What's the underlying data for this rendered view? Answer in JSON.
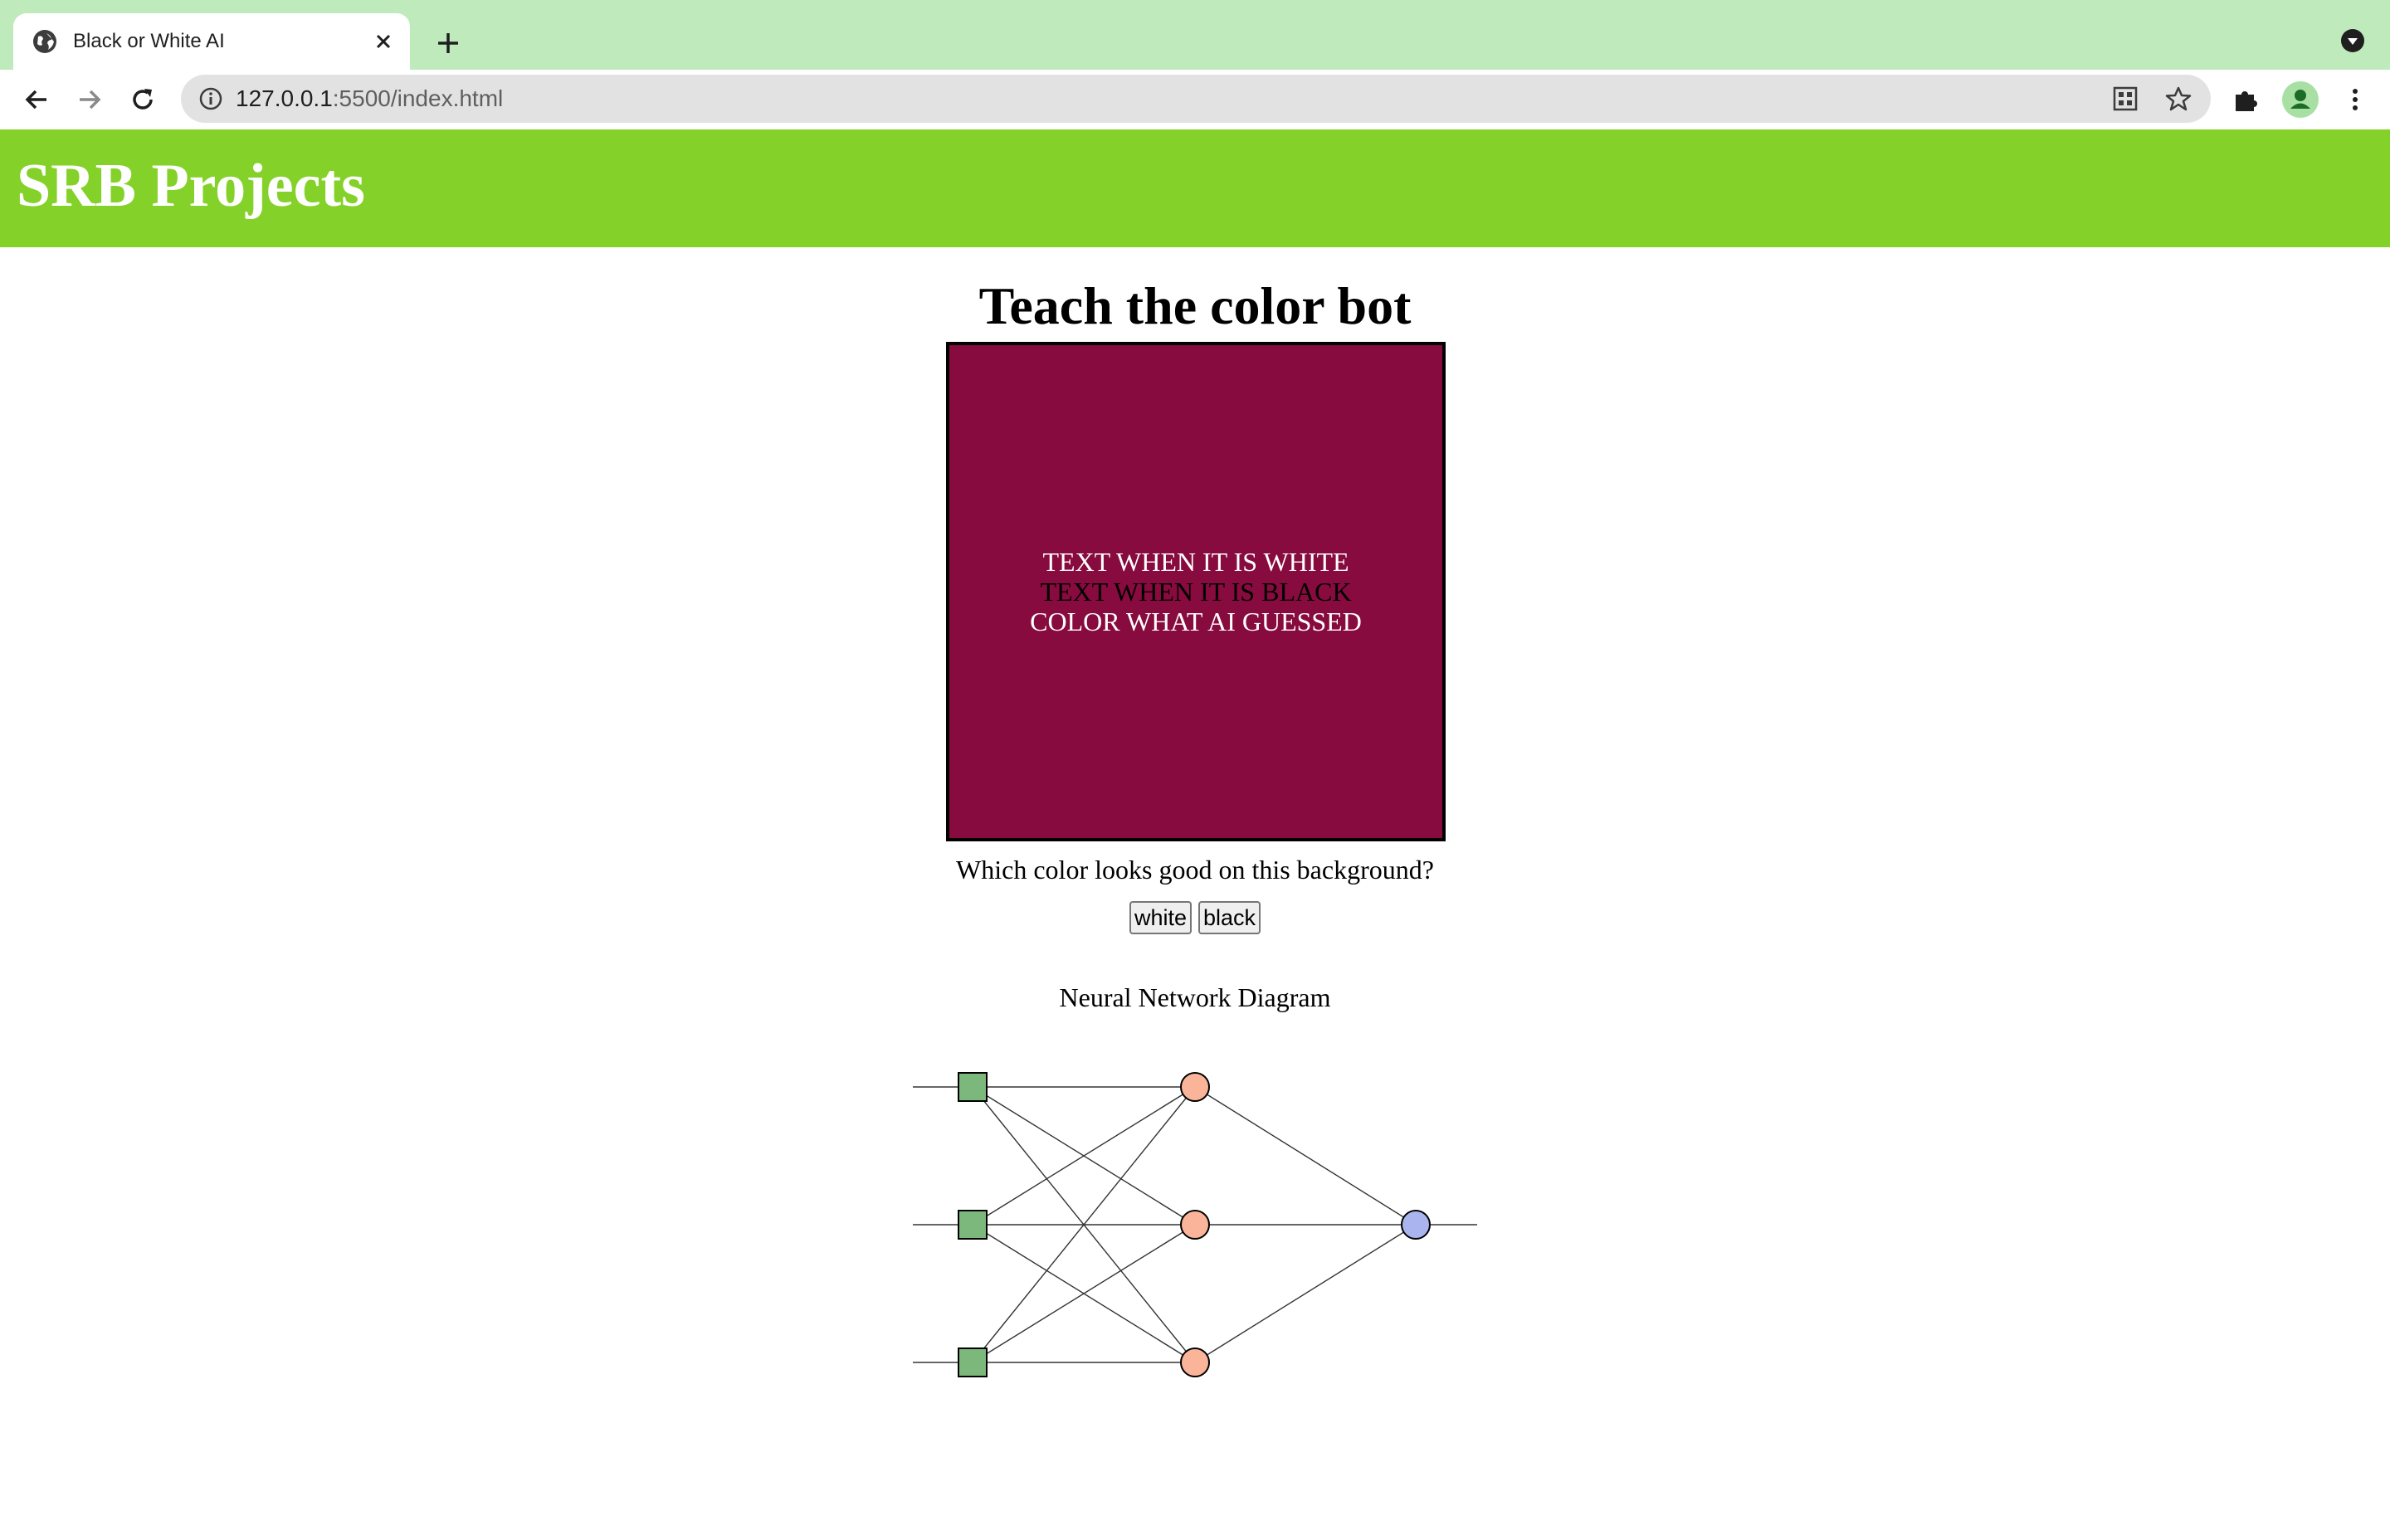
{
  "browser": {
    "tab_title": "Black or White AI",
    "url_host": "127.0.0.1",
    "url_rest": ":5500/index.html"
  },
  "page": {
    "site_title": "SRB Projects",
    "main_title": "Teach the color bot",
    "background_color": "#870b3e",
    "box_lines": [
      {
        "text": "TEXT WHEN IT IS WHITE",
        "color": "#ffffff"
      },
      {
        "text": "TEXT WHEN IT IS BLACK",
        "color": "#000000"
      },
      {
        "text": "COLOR WHAT AI GUESSED",
        "color": "#ffffff"
      }
    ],
    "question": "Which color looks good on this background?",
    "buttons": {
      "white_label": "white",
      "black_label": "black"
    },
    "diagram_label": "Neural Network Diagram"
  },
  "colors": {
    "header_green": "#84d229",
    "tabstrip_green": "#bfeabb",
    "input_node": "#7cb77c",
    "hidden_node": "#f9b499",
    "output_node": "#aab4ee"
  },
  "diagram": {
    "input_nodes": 3,
    "hidden_nodes": 3,
    "output_nodes": 1
  }
}
